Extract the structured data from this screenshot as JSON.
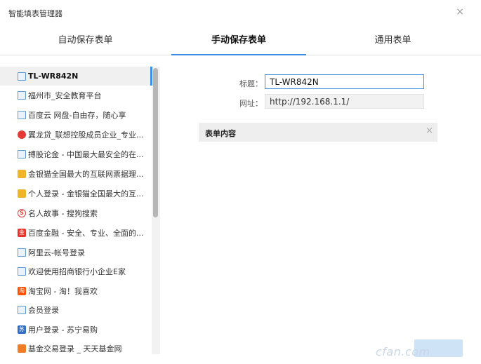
{
  "window": {
    "title": "智能填表管理器",
    "close_glyph": "×"
  },
  "tabs": [
    {
      "label": "自动保存表单",
      "active": false
    },
    {
      "label": "手动保存表单",
      "active": true
    },
    {
      "label": "通用表单",
      "active": false
    }
  ],
  "sidebar": {
    "items": [
      {
        "label": "TL-WR842N",
        "icon": "page-icon",
        "active": true
      },
      {
        "label": "福州市_安全教育平台",
        "icon": "page-icon"
      },
      {
        "label": "百度云 网盘-自由存，随心享",
        "icon": "page-icon"
      },
      {
        "label": "翼龙贷_联想控股成员企业_专业...",
        "icon": "yilongdai-logo-icon"
      },
      {
        "label": "搏股论金 - 中国最大最安全的在...",
        "icon": "page-icon"
      },
      {
        "label": "金银猫全国最大的互联网票据理...",
        "icon": "jinyinmao-logo-icon"
      },
      {
        "label": "个人登录 - 金银猫全国最大的互...",
        "icon": "jinyinmao-logo-icon"
      },
      {
        "label": "名人故事 - 搜狗搜索",
        "icon": "sogou-logo-icon",
        "glyph": "S"
      },
      {
        "label": "百度金融 - 安全、专业、全面的...",
        "icon": "baidu-finance-logo-icon",
        "glyph": "金"
      },
      {
        "label": "阿里云-帐号登录",
        "icon": "page-icon"
      },
      {
        "label": "欢迎使用招商银行小企业E家",
        "icon": "page-icon"
      },
      {
        "label": "淘宝网 - 淘！我喜欢",
        "icon": "taobao-logo-icon",
        "glyph": "淘"
      },
      {
        "label": "会员登录",
        "icon": "page-icon"
      },
      {
        "label": "用户登录 - 苏宁易购",
        "icon": "suning-logo-icon",
        "glyph": "苏"
      },
      {
        "label": "基金交易登录 _ 天天基金网",
        "icon": "tiantian-fund-logo-icon"
      }
    ]
  },
  "form": {
    "title_label": "标题：",
    "title_value": "TL-WR842N",
    "url_label": "网址：",
    "url_value": "http://192.168.1.1/"
  },
  "section": {
    "title": "表单内容",
    "close_glyph": "×"
  },
  "watermark": "cfan.com",
  "colors": {
    "accent": "#3b8fe0",
    "sidebar_active_bg": "#f0f0f0",
    "section_bg": "#eeeeee"
  }
}
